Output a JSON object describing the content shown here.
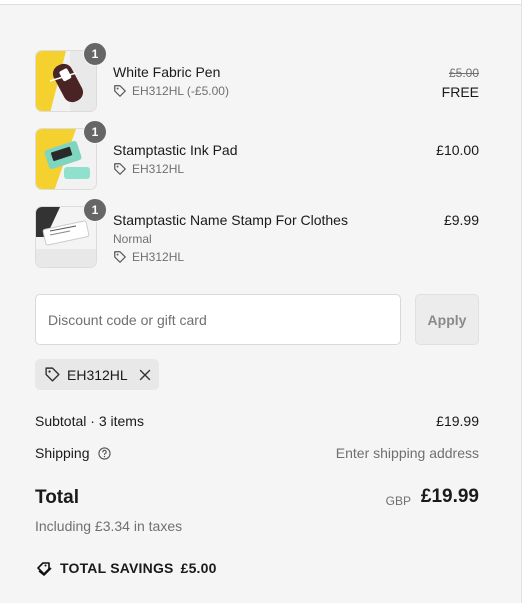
{
  "items": [
    {
      "name": "White Fabric Pen",
      "quantity": "1",
      "discount_code": "EH312HL (-£5.00)",
      "original_price": "£5.00",
      "price": "FREE",
      "image": "fabric-pen-thumbnail"
    },
    {
      "name": "Stamptastic Ink Pad",
      "quantity": "1",
      "discount_code": "EH312HL",
      "price": "£10.00",
      "image": "ink-pad-thumbnail"
    },
    {
      "name": "Stamptastic Name Stamp For Clothes",
      "quantity": "1",
      "variant": "Normal",
      "discount_code": "EH312HL",
      "price": "£9.99",
      "image": "name-stamp-thumbnail"
    }
  ],
  "discount": {
    "placeholder": "Discount code or gift card",
    "apply_label": "Apply",
    "applied_code": "EH312HL"
  },
  "summary": {
    "subtotal_label": "Subtotal · 3 items",
    "subtotal_value": "£19.99",
    "shipping_label": "Shipping",
    "shipping_value": "Enter shipping address",
    "total_label": "Total",
    "currency": "GBP",
    "total_value": "£19.99",
    "taxes_note": "Including £3.34 in taxes",
    "savings_label": "TOTAL SAVINGS",
    "savings_value": "£5.00"
  },
  "colors": {
    "background": "#f5f5f5",
    "badge": "#666666",
    "muted_text": "#707070"
  }
}
